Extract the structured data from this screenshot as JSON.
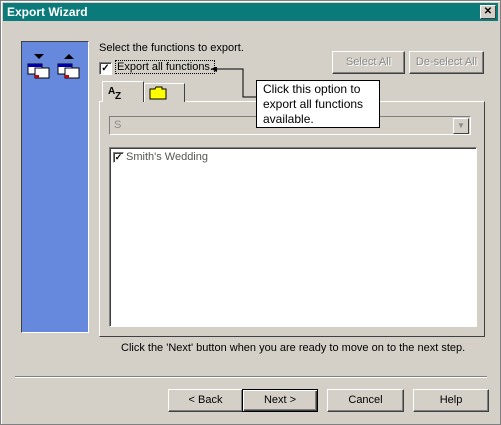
{
  "window": {
    "title": "Export Wizard",
    "close_glyph": "✕"
  },
  "main": {
    "instruction": "Select the functions to export.",
    "select_all": "Select All",
    "deselect_all": "De-select All",
    "export_all_label": "Export all functions.",
    "export_all_checked": true,
    "tabs": [
      {
        "label": "AZ",
        "icon": "sort-az-icon"
      },
      {
        "label": "",
        "icon": "folder-icon"
      }
    ],
    "filter_value": "S",
    "list_items": [
      {
        "label": "Smith's Wedding",
        "checked": true
      }
    ],
    "tooltip": "Click this option to export all functions available.",
    "footer_hint": "Click the 'Next' button when you are ready to move on to the next step."
  },
  "buttons": {
    "back": "< Back",
    "next": "Next >",
    "cancel": "Cancel",
    "help": "Help"
  }
}
